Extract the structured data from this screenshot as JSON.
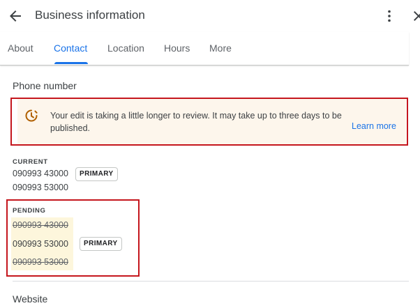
{
  "header": {
    "title": "Business information"
  },
  "tabs": [
    {
      "label": "About",
      "active": false
    },
    {
      "label": "Contact",
      "active": true
    },
    {
      "label": "Location",
      "active": false
    },
    {
      "label": "Hours",
      "active": false
    },
    {
      "label": "More",
      "active": false
    }
  ],
  "phone_section": {
    "title": "Phone number",
    "notice": {
      "icon": "pending-clock-icon",
      "text": "Your edit is taking a little longer to review. It may take up to three days to be published.",
      "link": "Learn more"
    },
    "current": {
      "label": "CURRENT",
      "numbers": [
        {
          "value": "090993 43000",
          "badge": "PRIMARY"
        },
        {
          "value": "090993 53000",
          "badge": ""
        }
      ]
    },
    "pending": {
      "label": "PENDING",
      "numbers": [
        {
          "value": "090993 43000",
          "struck": true,
          "badge": ""
        },
        {
          "value": "090993 53000",
          "struck": false,
          "badge": "PRIMARY"
        },
        {
          "value": "090993 53000",
          "struck": true,
          "badge": ""
        }
      ]
    }
  },
  "website_section": {
    "title": "Website"
  },
  "colors": {
    "accent": "#1a73e8",
    "notice_bg": "#fdf6ec",
    "pending_bg": "#fdf6dc",
    "warning_icon": "#b06000",
    "highlight_border": "#c5161d"
  }
}
